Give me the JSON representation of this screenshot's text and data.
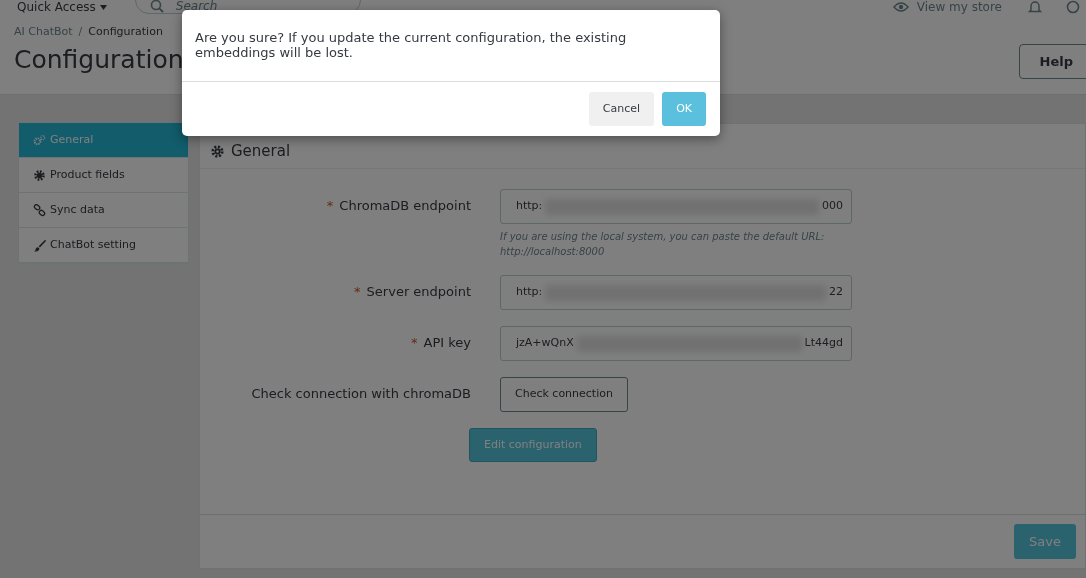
{
  "header": {
    "quick_access": "Quick Access",
    "search_placeholder": "Search",
    "view_store": "View my store"
  },
  "breadcrumb": [
    "AI ChatBot",
    "Configuration"
  ],
  "breadcrumb_separator": "/",
  "page_title": "Configuration",
  "help_button": "Help",
  "sidebar": {
    "items": [
      {
        "label": "General",
        "selected": true
      },
      {
        "label": "Product fields",
        "selected": false
      },
      {
        "label": "Sync data",
        "selected": false
      },
      {
        "label": "ChatBot setting",
        "selected": false
      }
    ]
  },
  "panel": {
    "title": "General",
    "fields": [
      {
        "kind": "text",
        "label": "ChromaDB endpoint",
        "required_mark": "*",
        "value_start": "http:",
        "value_end": "000",
        "help": "If you are using the local system, you can paste the default URL: http://localhost:8000"
      },
      {
        "kind": "text",
        "label": "Server endpoint",
        "required_mark": "*",
        "value_start": "http:",
        "value_end": "22"
      },
      {
        "kind": "text",
        "label": "API key",
        "required_mark": "*",
        "value_start": "jzA+wQnX",
        "value_end": "Lt44gd"
      },
      {
        "kind": "button",
        "label": "Check connection with chromaDB",
        "button": "Check connection"
      }
    ],
    "edit_button": "Edit configuration",
    "save_button": "Save"
  },
  "modal": {
    "message": "Are you sure? If you update the current configuration, the existing embeddings will be lost.",
    "buttons": [
      {
        "label": "Cancel",
        "kind": "secondary"
      },
      {
        "label": "OK",
        "kind": "primary"
      }
    ]
  }
}
